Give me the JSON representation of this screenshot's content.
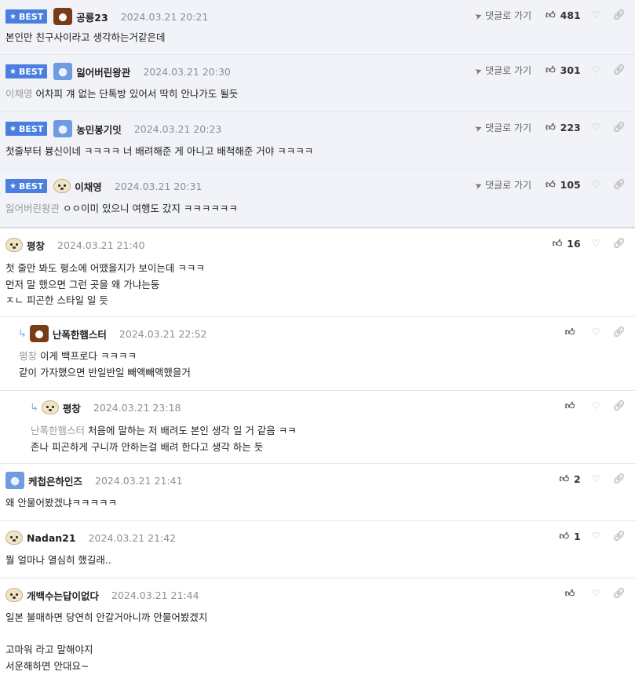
{
  "labels": {
    "best": "BEST",
    "go_reply": "댓글로 가기"
  },
  "comments": [
    {
      "nick": "공룡23",
      "date": "2024.03.21 20:21",
      "likes": "481",
      "mention": "",
      "text": "본인만 친구사이라고 생각하는거같은데"
    },
    {
      "nick": "잃어버린왕관",
      "date": "2024.03.21 20:30",
      "likes": "301",
      "mention": "이채영",
      "text": "어차피 걔 없는 단톡방 있어서 딱히 안나가도 될듯"
    },
    {
      "nick": "농민봉기잇",
      "date": "2024.03.21 20:23",
      "likes": "223",
      "mention": "",
      "text": "첫줄부터 븅신이네 ㅋㅋㅋㅋ 너 배려해준 게 아니고 배척해준 거야 ㅋㅋㅋㅋ"
    },
    {
      "nick": "이채영",
      "date": "2024.03.21 20:31",
      "likes": "105",
      "mention": "잃어버린왕관",
      "text": "ㅇㅇ이미 있으니 여행도 갔지 ㅋㅋㅋㅋㅋㅋ"
    },
    {
      "nick": "평창",
      "date": "2024.03.21 21:40",
      "likes": "16",
      "mention": "",
      "text": "첫 줄만 봐도 평소에 어땠을지가 보이는데 ㅋㅋㅋ\n먼저 말 했으면 그런 곳을 왜 가냐는둥\nㅈㄴ 피곤한 스타일 일 듯"
    },
    {
      "nick": "난폭한햄스터",
      "date": "2024.03.21 22:52",
      "likes": "",
      "mention": "평창",
      "text": "이게 백프로다 ㅋㅋㅋㅋ\n같이 가자했으면 반일반일 빼액빼액했을거"
    },
    {
      "nick": "평창",
      "date": "2024.03.21 23:18",
      "likes": "",
      "mention": "난폭한햄스터",
      "text": "처음에 말하는 저 배려도 본인 생각 일 거 같음 ㅋㅋ\n존나 피곤하게 구니까 안하는걸 배려 한다고 생각 하는 듯"
    },
    {
      "nick": "케첩은하인즈",
      "date": "2024.03.21 21:41",
      "likes": "2",
      "mention": "",
      "text": "왜 안물어봤겠냐ㅋㅋㅋㅋㅋ"
    },
    {
      "nick": "Nadan21",
      "date": "2024.03.21 21:42",
      "likes": "1",
      "mention": "",
      "text": "뭘 얼마나 열심히 했길래.."
    },
    {
      "nick": "개백수는답이없다",
      "date": "2024.03.21 21:44",
      "likes": "",
      "mention": "",
      "text": "일본 불매하면 당연히 안갈거아니까 안물어봤겠지\n\n고마워 라고 말해야지\n서운해하면 안대요~"
    }
  ]
}
